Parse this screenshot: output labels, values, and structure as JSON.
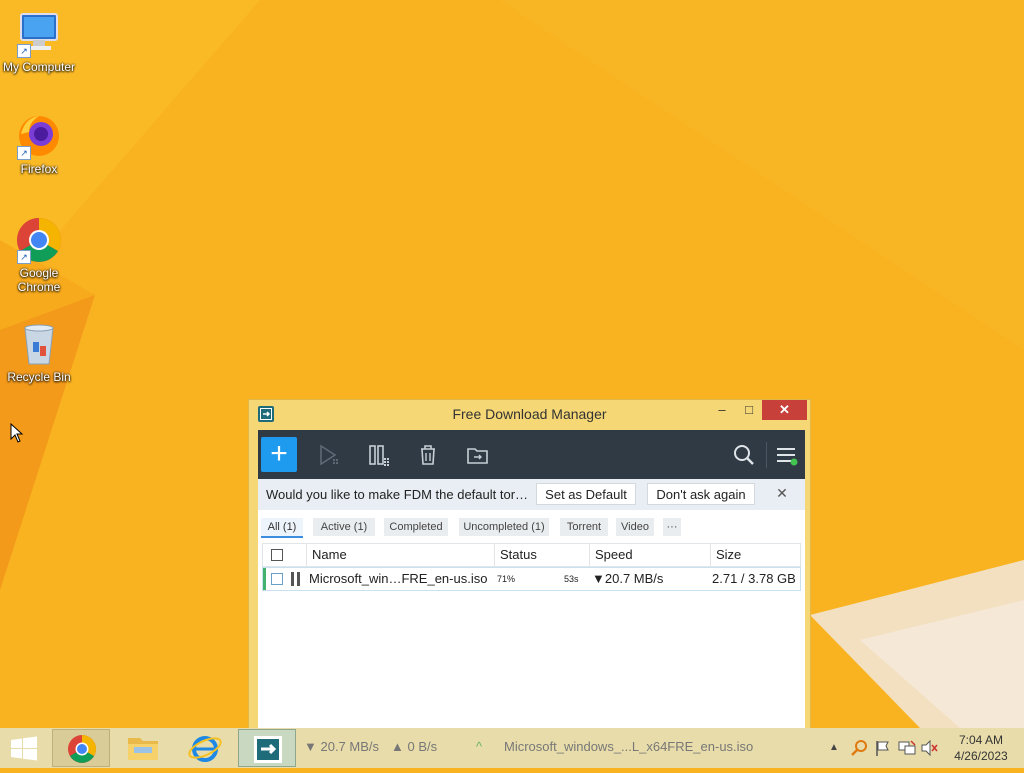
{
  "desktop": {
    "icons": [
      {
        "label": "My Computer",
        "icon": "computer-icon"
      },
      {
        "label": "Firefox",
        "icon": "firefox-icon"
      },
      {
        "label": "Google Chrome",
        "icon": "chrome-icon"
      },
      {
        "label": "Recycle Bin",
        "icon": "recycle-bin-icon"
      }
    ]
  },
  "window": {
    "title": "Free Download Manager",
    "minimize_glyph": "–",
    "maximize_glyph": "□",
    "close_glyph": "✕"
  },
  "toolbar": {
    "add_glyph": "+",
    "buttons": [
      "add-download-icon",
      "resume-icon",
      "pause-icon",
      "delete-icon",
      "move-folder-icon",
      "search-icon",
      "menu-icon"
    ]
  },
  "notification": {
    "text": "Would you like to make FDM the default tor…",
    "set_default": "Set as Default",
    "dont_ask": "Don't ask again",
    "close_glyph": "✕"
  },
  "filters": [
    "All (1)",
    "Active (1)",
    "Completed",
    "Uncompleted (1)",
    "Torrent",
    "Video",
    "···"
  ],
  "table": {
    "columns": [
      "Name",
      "Status",
      "Speed",
      "Size"
    ],
    "rows": [
      {
        "name": "Microsoft_win…FRE_en-us.iso",
        "status_percent": "71%",
        "status_eta": "53s",
        "speed": "▼20.7 MB/s",
        "size": "2.71 / 3.78 GB"
      }
    ]
  },
  "taskbar": {
    "download_speed": "▼ 20.7 MB/s",
    "upload_speed": "▲ 0 B/s",
    "expand_glyph": "^",
    "current_file": "Microsoft_windows_...L_x64FRE_en-us.iso",
    "tray_arrow": "▲",
    "time": "7:04 AM",
    "date": "4/26/2023"
  },
  "colors": {
    "desktop_bg": "#f9b320",
    "toolbar_bg": "#2f3a45",
    "add_button": "#1e9bef",
    "close_button": "#c7403a",
    "progress_green": "#43b26f"
  }
}
